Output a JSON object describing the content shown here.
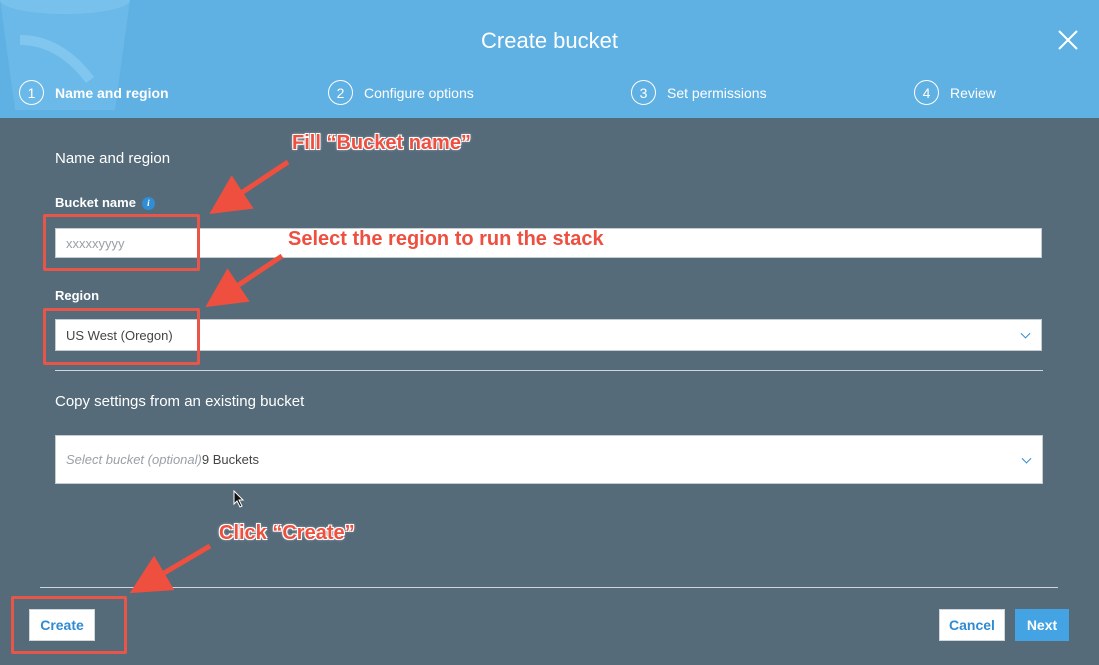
{
  "dialog": {
    "title": "Create bucket"
  },
  "steps": [
    {
      "number": "1",
      "label": "Name and region",
      "active": true
    },
    {
      "number": "2",
      "label": "Configure options",
      "active": false
    },
    {
      "number": "3",
      "label": "Set permissions",
      "active": false
    },
    {
      "number": "4",
      "label": "Review",
      "active": false
    }
  ],
  "form": {
    "section_title": "Name and region",
    "bucket_name_label": "Bucket name",
    "bucket_name_value": "xxxxxyyyy",
    "region_label": "Region",
    "region_value": "US West (Oregon)",
    "copy_settings_label": "Copy settings from an existing bucket",
    "copy_select_placeholder": "Select bucket (optional)",
    "copy_select_count": "9 Buckets"
  },
  "footer": {
    "create_label": "Create",
    "cancel_label": "Cancel",
    "next_label": "Next"
  },
  "annotations": {
    "fill_bucket": "Fill “Bucket name”",
    "select_region": "Select the region to run the stack",
    "click_create": "Click “Create”"
  },
  "icons": {
    "close": "close-icon",
    "info": "info-icon",
    "chevron": "chevron-down-icon"
  },
  "colors": {
    "header_bg": "#5fb0e3",
    "body_bg": "#566b7a",
    "primary_blue": "#44a3e2",
    "annotation_red": "#ee4f3f"
  }
}
